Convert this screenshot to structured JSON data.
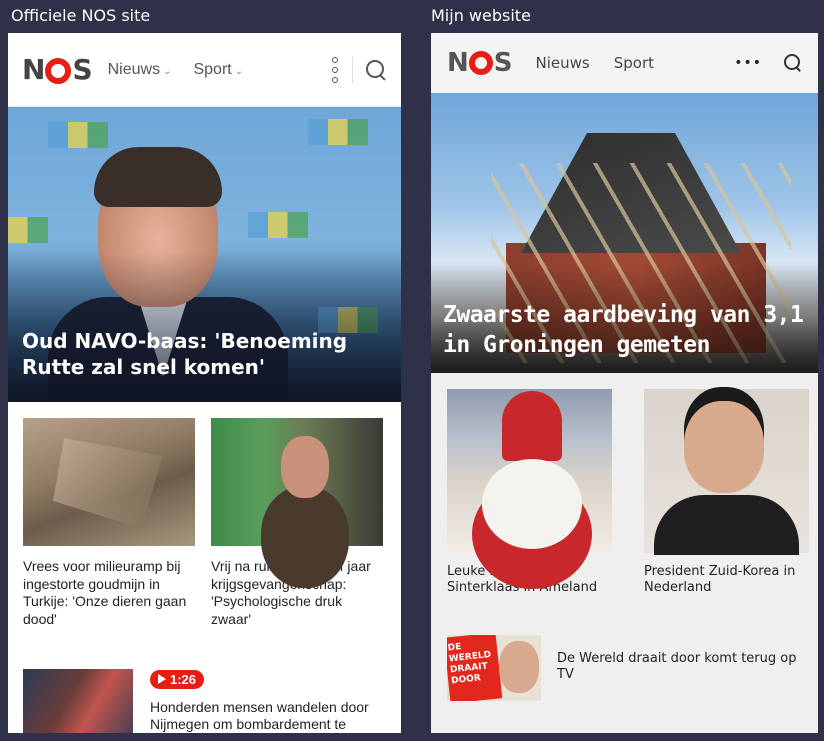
{
  "panels": {
    "left_title": "Officiele NOS site",
    "right_title": "Mijn website"
  },
  "left": {
    "logo": {
      "n": "N",
      "s": "S"
    },
    "nav": [
      {
        "label": "Nieuws",
        "chevron": "⌄"
      },
      {
        "label": "Sport",
        "chevron": "⌄"
      }
    ],
    "icons": [
      "more-vertical-icon",
      "search-icon"
    ],
    "hero_headline": "Oud NAVO-baas: 'Benoeming Rutte zal snel komen'",
    "cards": [
      {
        "caption": "Vrees voor milieuramp bij ingestorte goudmijn in Turkije: 'Onze dieren gaan dood'"
      },
      {
        "caption": "Vrij na ruim anderhalf jaar krijgsgevangenschap: 'Psychologische druk zwaar'"
      }
    ],
    "video_item": {
      "duration": "1:26",
      "caption": "Honderden mensen wandelen door Nijmegen om bombardement te"
    }
  },
  "right": {
    "logo": {
      "n": "N",
      "s": "S"
    },
    "nav": [
      "Nieuws",
      "Sport"
    ],
    "more_label": "•••",
    "hero_headline": "Zwaarste aardbeving van 3,1 in Groningen gemeten",
    "cards": [
      {
        "caption": "Leuke intocht van Sinterklaas in Ameland"
      },
      {
        "caption": "President Zuid-Korea in Nederland"
      }
    ],
    "list_item": {
      "thumb_logo": "DE WERELD DRAAIT DOOR",
      "caption": "De Wereld draait door komt terug op TV"
    }
  },
  "colors": {
    "background": "#2e3148",
    "nos_red": "#e61e14"
  }
}
